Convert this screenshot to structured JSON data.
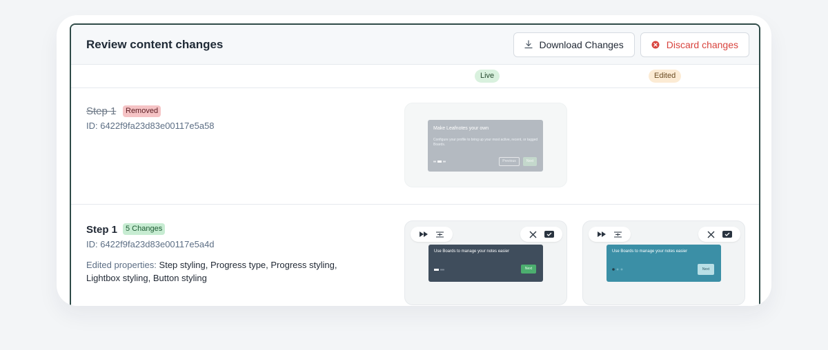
{
  "header": {
    "title": "Review content changes",
    "download_label": "Download Changes",
    "discard_label": "Discard changes"
  },
  "columns": {
    "live": "Live",
    "edited": "Edited"
  },
  "steps": [
    {
      "title": "Step 1",
      "badge": "Removed",
      "id": "ID: 6422f9fa23d83e00117e5a58",
      "live_preview": {
        "title": "Make Leafnotes your own",
        "body": "Configure your profile to bring up your most active, recent, or tagged Boards.",
        "prev_label": "Previous",
        "next_label": "Next"
      }
    },
    {
      "title": "Step 1",
      "badge": "5 Changes",
      "id": "ID: 6422f9fa23d83e00117e5a4d",
      "edited_label": "Edited properties:",
      "edited_values": "Step styling, Progress type, Progress styling, Lightbox styling, Button styling",
      "live_preview": {
        "title": "Use Boards to manage your notes easier",
        "next_label": "Next"
      },
      "edited_preview": {
        "title": "Use Boards to manage your notes easier",
        "next_label": "Next"
      }
    }
  ],
  "colors": {
    "panel_border": "#2e4a47",
    "discard": "#d8433d",
    "live_modal": "#3f4d5c",
    "live_next": "#4cae6f",
    "edited_modal": "#3b8fa6",
    "edited_next": "#b8dfe6"
  }
}
